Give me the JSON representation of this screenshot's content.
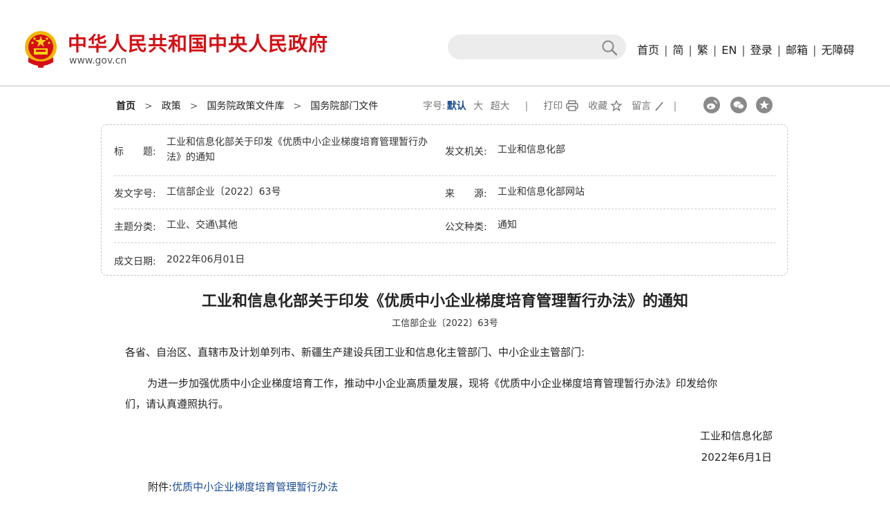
{
  "header": {
    "site_title": "中华人民共和国中央人民政府",
    "site_domain": "www.gov.cn",
    "search_placeholder": "",
    "nav": [
      "首页",
      "简",
      "繁",
      "EN",
      "登录",
      "邮箱",
      "无障碍"
    ],
    "separator": "|"
  },
  "breadcrumb": {
    "items": [
      "首页",
      "政策",
      "国务院政策文件库",
      "国务院部门文件"
    ],
    "arrow": ">"
  },
  "tools": {
    "font_size_label": "字号:",
    "font_sizes": [
      "默认",
      "大",
      "超大"
    ],
    "print": "打印",
    "favorite": "收藏",
    "comment": "留言",
    "bar": "|"
  },
  "meta": {
    "title_label": "标　　题:",
    "title_value": "工业和信息化部关于印发《优质中小企业梯度培育管理暂行办法》的通知",
    "issuer_label": "发文机关:",
    "issuer_value": "工业和信息化部",
    "doc_no_label": "发文字号:",
    "doc_no_value": "工信部企业〔2022〕63号",
    "source_label": "来　　源:",
    "source_value": "工业和信息化部网站",
    "topic_label": "主题分类:",
    "topic_value": "工业、交通\\其他",
    "type_label": "公文种类:",
    "type_value": "通知",
    "date_label": "成文日期:",
    "date_value": "2022年06月01日"
  },
  "document": {
    "title": "工业和信息化部关于印发《优质中小企业梯度培育管理暂行办法》的通知",
    "number": "工信部企业〔2022〕63号",
    "salutation": "各省、自治区、直辖市及计划单列市、新疆生产建设兵团工业和信息化主管部门、中小企业主管部门:",
    "paragraph_line1": "为进一步加强优质中小企业梯度培育工作，推动中小企业高质量发展，现将《优质中小企业梯度培育管理暂行办法》印发给你",
    "paragraph_line2": "们，请认真遵照执行。",
    "signer": "工业和信息化部",
    "sign_date": "2022年6月1日",
    "attachment_label": "附件:",
    "attachment_link": "优质中小企业梯度培育管理暂行办法"
  },
  "colors": {
    "brand_red": "#d40f14",
    "link_blue": "#1b4b91",
    "icon_gray": "#8a8a8a"
  }
}
